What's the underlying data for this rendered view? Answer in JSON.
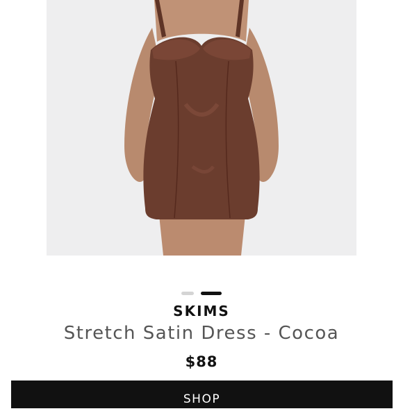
{
  "product": {
    "brand": "SKIMS",
    "title": "Stretch Satin Dress - Cocoa",
    "price": "$88",
    "image_icon": "product-photo",
    "color_name": "Cocoa",
    "dress_color": "#6b3d2e"
  },
  "carousel": {
    "slide_count": 2,
    "active_index": 1
  },
  "actions": {
    "shop_label": "SHOP"
  },
  "colors": {
    "button_bg": "#111111",
    "button_text": "#ffffff",
    "dot_active": "#111111",
    "dot_inactive": "#d4d4d4",
    "image_bg": "#eeeeef"
  }
}
